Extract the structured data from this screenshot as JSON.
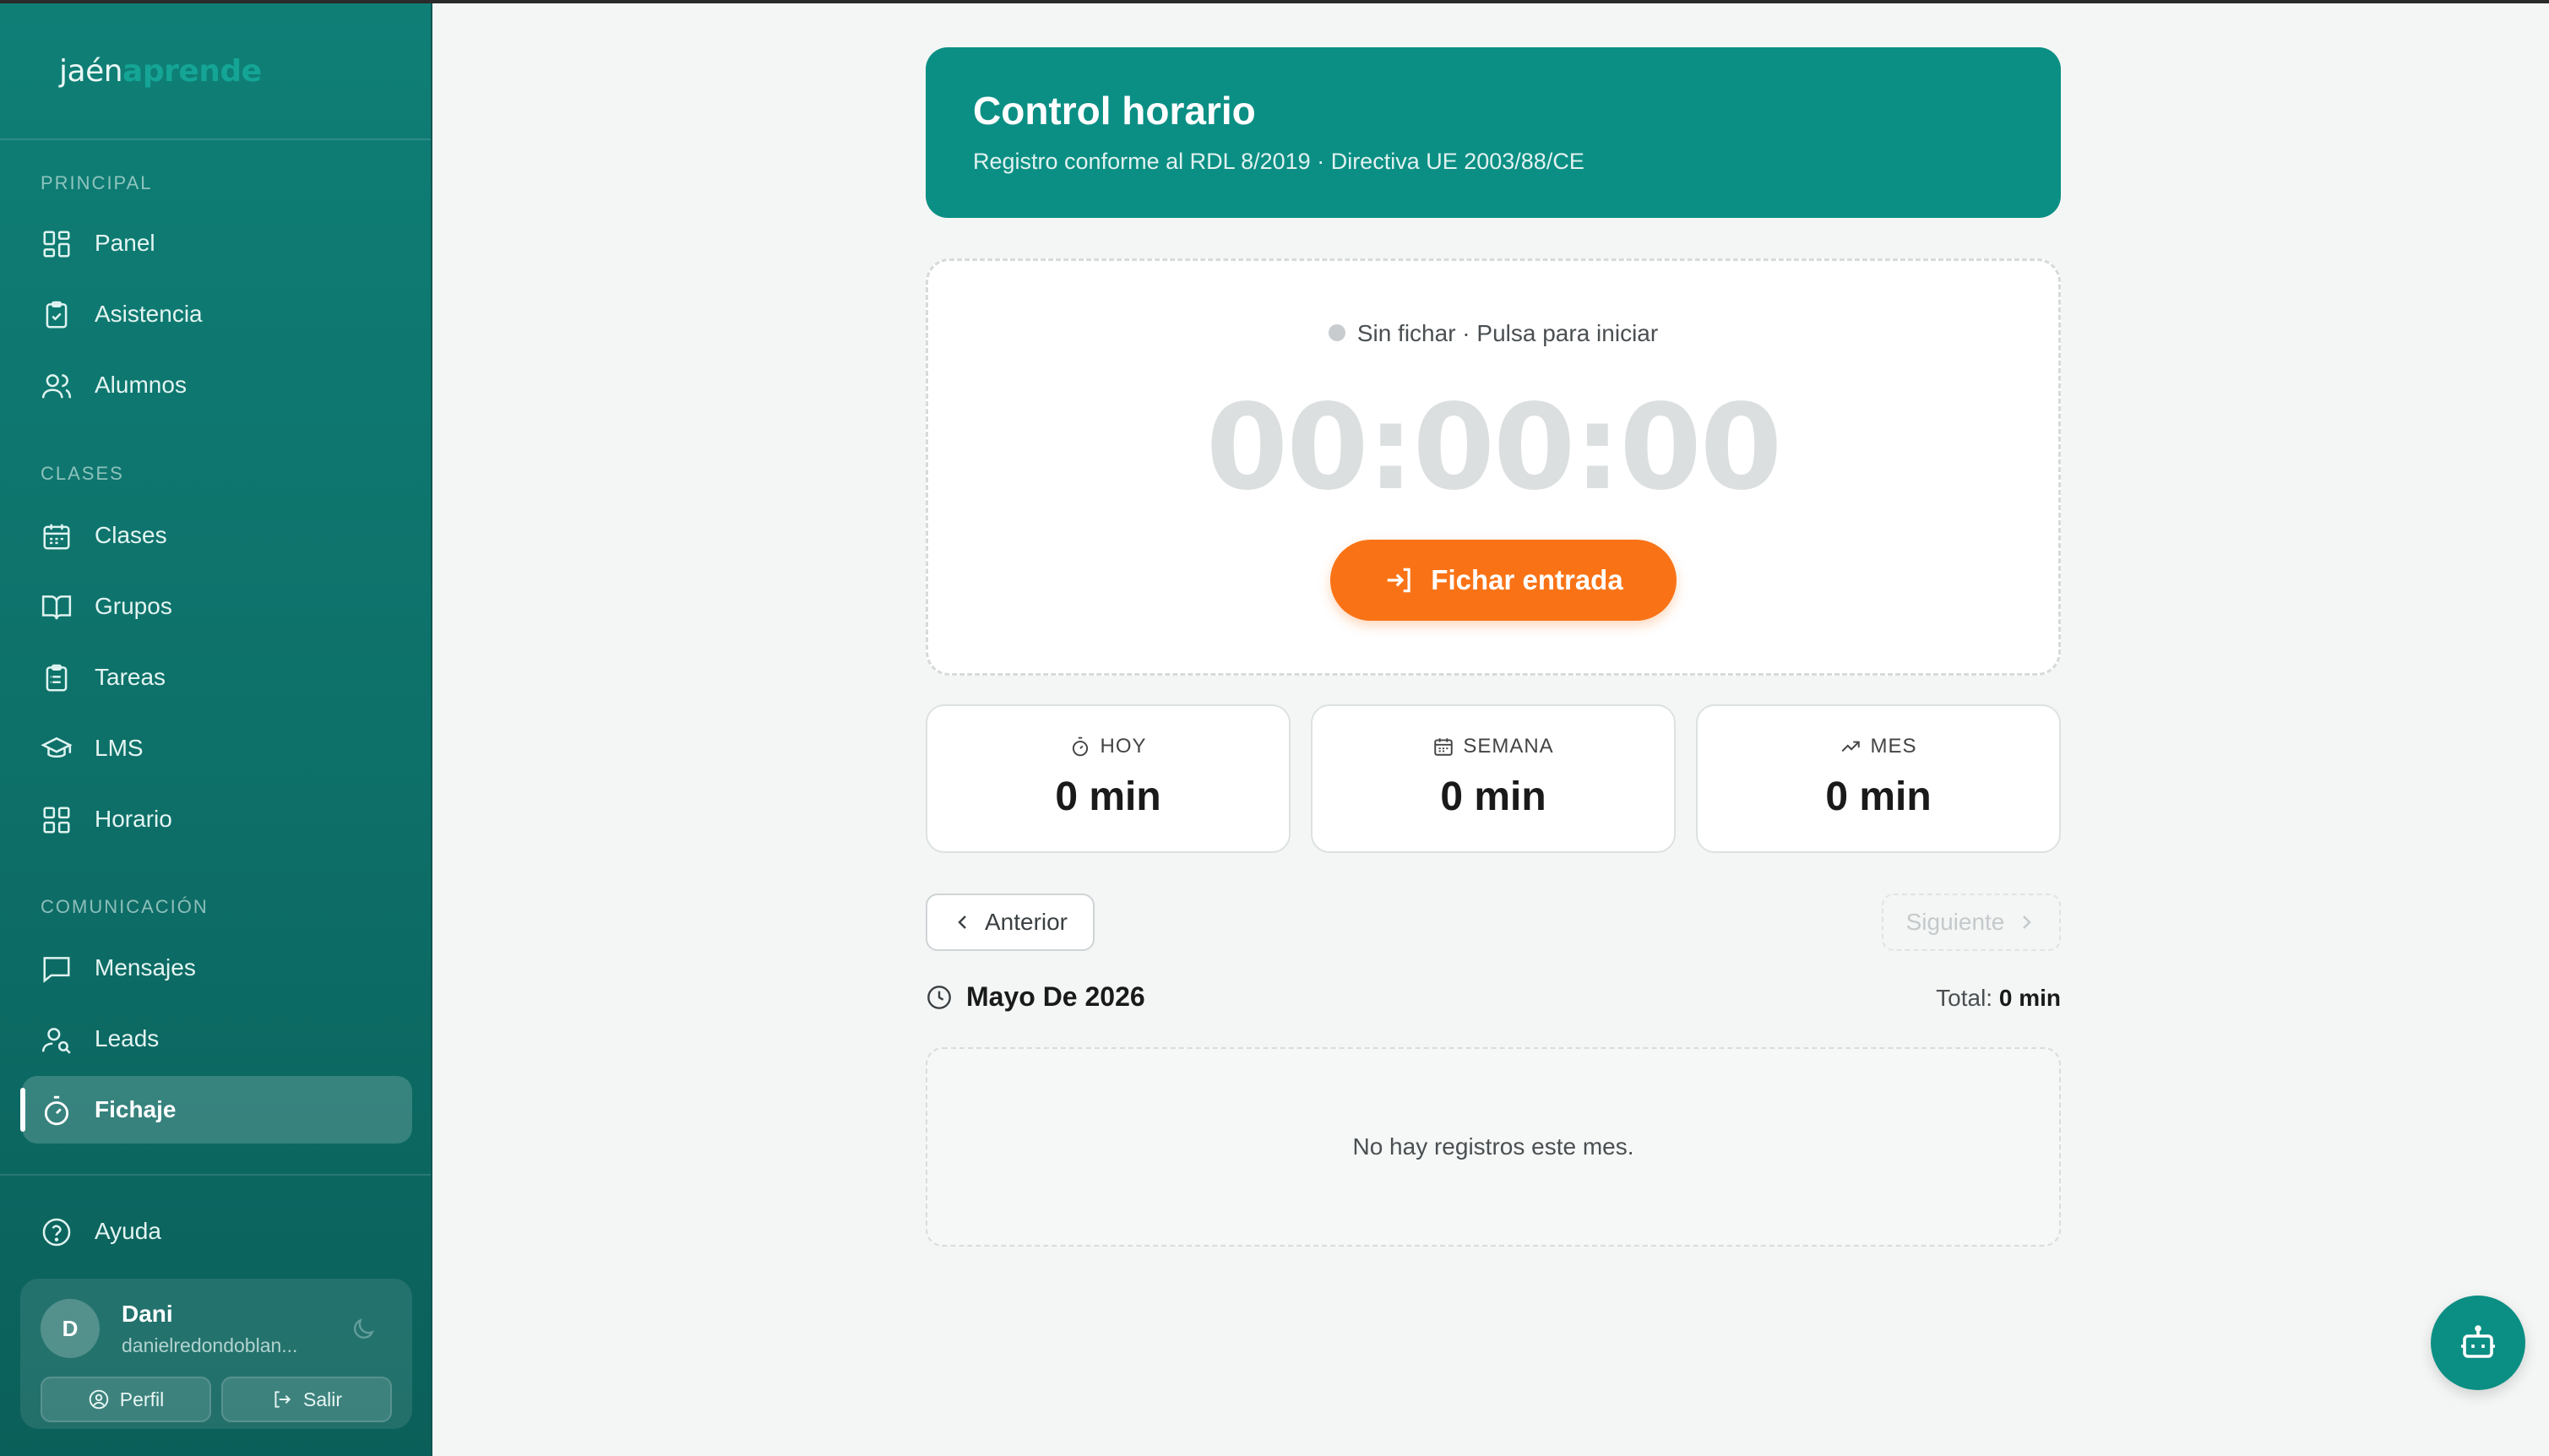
{
  "brand": {
    "part1": "jaén",
    "part2": "aprende"
  },
  "sidebar": {
    "sections": [
      {
        "label": "PRINCIPAL"
      },
      {
        "label": "CLASES"
      },
      {
        "label": "COMUNICACIÓN"
      }
    ],
    "items": [
      {
        "label": "Panel",
        "icon": "grid-icon"
      },
      {
        "label": "Asistencia",
        "icon": "clipboard-check-icon"
      },
      {
        "label": "Alumnos",
        "icon": "users-icon"
      },
      {
        "label": "Clases",
        "icon": "calendar-icon"
      },
      {
        "label": "Grupos",
        "icon": "book-open-icon"
      },
      {
        "label": "Tareas",
        "icon": "clipboard-list-icon"
      },
      {
        "label": "LMS",
        "icon": "graduation-cap-icon"
      },
      {
        "label": "Horario",
        "icon": "grid-icon"
      },
      {
        "label": "Mensajes",
        "icon": "message-square-icon"
      },
      {
        "label": "Leads",
        "icon": "user-search-icon"
      },
      {
        "label": "Fichaje",
        "icon": "stopwatch-icon",
        "active": true
      }
    ],
    "help_label": "Ayuda",
    "user": {
      "initial": "D",
      "name": "Dani",
      "email": "danielredondoblan...",
      "profile_label": "Perfil",
      "logout_label": "Salir"
    }
  },
  "header": {
    "title": "Control horario",
    "subtitle": "Registro conforme al RDL 8/2019 · Directiva UE 2003/88/CE"
  },
  "clock": {
    "status": "Sin fichar · Pulsa para iniciar",
    "timer": "00:00:00",
    "button_label": "Fichar entrada"
  },
  "stats": [
    {
      "label": "HOY",
      "value": "0 min",
      "icon": "stopwatch-icon"
    },
    {
      "label": "SEMANA",
      "value": "0 min",
      "icon": "calendar-icon"
    },
    {
      "label": "MES",
      "value": "0 min",
      "icon": "trending-up-icon"
    }
  ],
  "pagination": {
    "prev_label": "Anterior",
    "next_label": "Siguiente"
  },
  "month": {
    "title": "Mayo De 2026",
    "total_label": "Total:",
    "total_value": "0 min"
  },
  "records": {
    "empty_message": "No hay registros este mes."
  },
  "colors": {
    "sidebar": "#0d6f68",
    "header": "#0b8f84",
    "accent_orange": "#f97316",
    "background": "#f4f6f5"
  }
}
